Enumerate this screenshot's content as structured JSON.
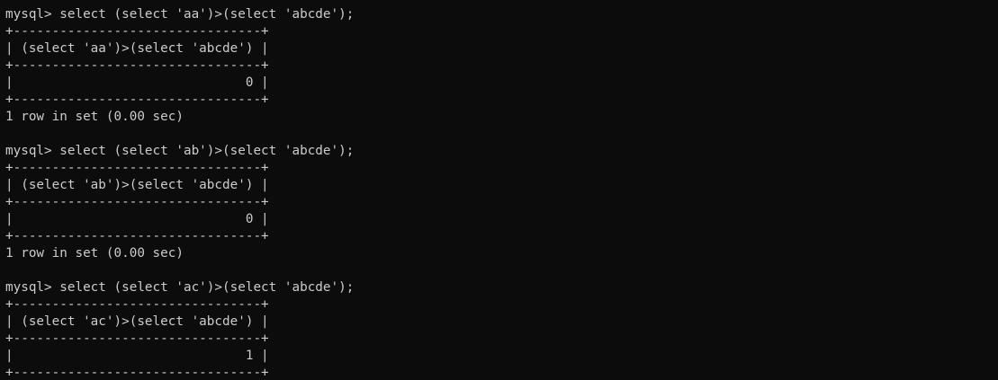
{
  "terminal": {
    "lines": [
      "mysql> select (select 'aa')>(select 'abcde');",
      "+--------------------------------+",
      "| (select 'aa')>(select 'abcde') |",
      "+--------------------------------+",
      "|                              0 |",
      "+--------------------------------+",
      "1 row in set (0.00 sec)",
      "",
      "mysql> select (select 'ab')>(select 'abcde');",
      "+--------------------------------+",
      "| (select 'ab')>(select 'abcde') |",
      "+--------------------------------+",
      "|                              0 |",
      "+--------------------------------+",
      "1 row in set (0.00 sec)",
      "",
      "mysql> select (select 'ac')>(select 'abcde');",
      "+--------------------------------+",
      "| (select 'ac')>(select 'abcde') |",
      "+--------------------------------+",
      "|                              1 |",
      "+--------------------------------+"
    ]
  },
  "colors": {
    "background": "#0c0c0c",
    "foreground": "#cccccc"
  }
}
